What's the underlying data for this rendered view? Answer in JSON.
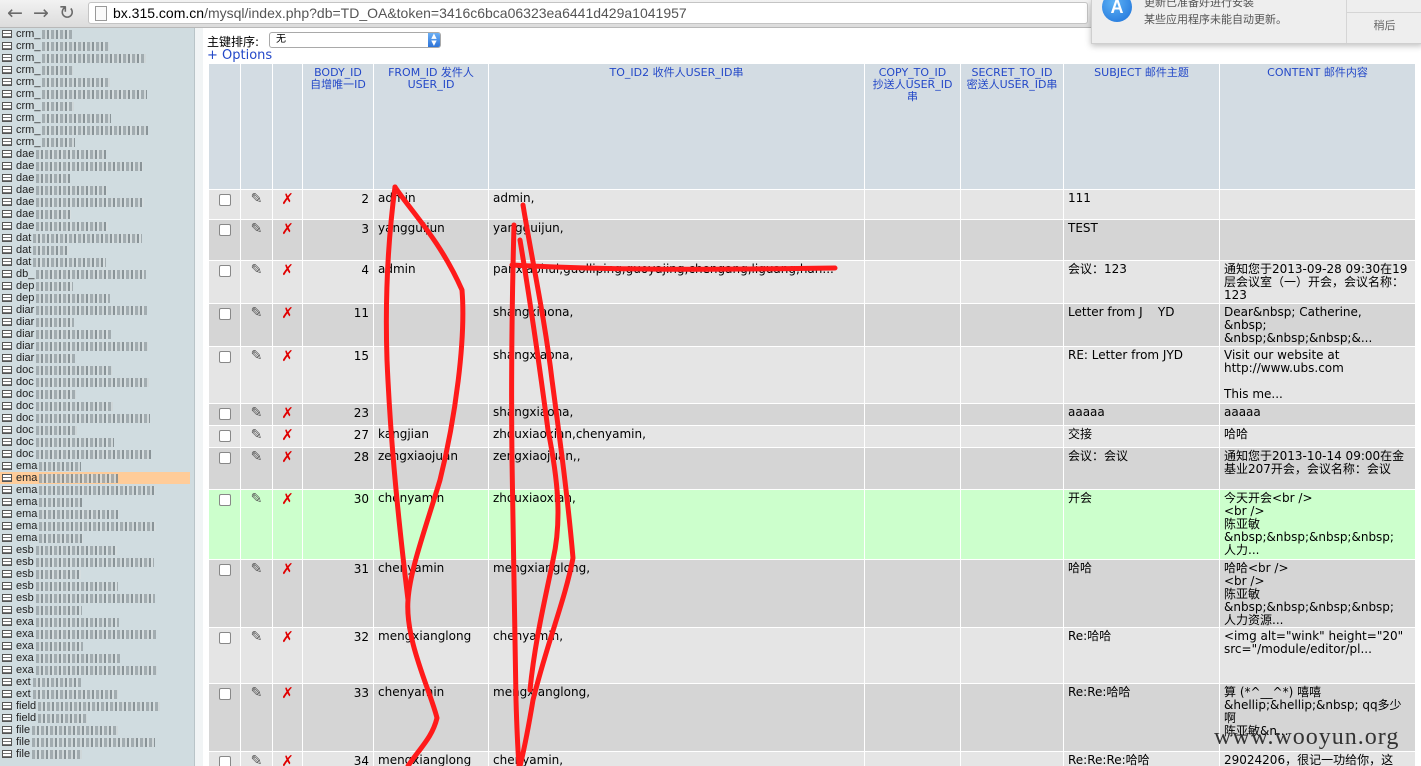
{
  "browser": {
    "url_host": "bx.315.com.cn",
    "url_rest": "/mysql/index.php?db=TD_OA&token=3416c6bca06323ea6441d429a1041957",
    "back_icon": "arrow-left-icon",
    "forward_icon": "arrow-right-icon",
    "reload_icon": "reload-icon"
  },
  "notification": {
    "title": "更新已准备好进行安装",
    "body": "某些应用程序未能自动更新。",
    "later_label": "稍后",
    "icon": "app-store-icon"
  },
  "sidebar": {
    "items": [
      {
        "label": "crm_"
      },
      {
        "label": "crm_"
      },
      {
        "label": "crm_"
      },
      {
        "label": "crm_"
      },
      {
        "label": "crm_"
      },
      {
        "label": "crm_"
      },
      {
        "label": "crm_"
      },
      {
        "label": "crm_"
      },
      {
        "label": "crm_"
      },
      {
        "label": "crm_"
      },
      {
        "label": "dae"
      },
      {
        "label": "dae"
      },
      {
        "label": "dae"
      },
      {
        "label": "dae"
      },
      {
        "label": "dae"
      },
      {
        "label": "dae"
      },
      {
        "label": "dae"
      },
      {
        "label": "dat"
      },
      {
        "label": "dat"
      },
      {
        "label": "dat"
      },
      {
        "label": "db_"
      },
      {
        "label": "dep"
      },
      {
        "label": "dep"
      },
      {
        "label": "diar"
      },
      {
        "label": "diar"
      },
      {
        "label": "diar"
      },
      {
        "label": "diar"
      },
      {
        "label": "diar"
      },
      {
        "label": "doc"
      },
      {
        "label": "doc"
      },
      {
        "label": "doc"
      },
      {
        "label": "doc"
      },
      {
        "label": "doc"
      },
      {
        "label": "doc"
      },
      {
        "label": "doc"
      },
      {
        "label": "doc"
      },
      {
        "label": "ema"
      },
      {
        "label": "ema",
        "active": true
      },
      {
        "label": "ema"
      },
      {
        "label": "ema"
      },
      {
        "label": "ema"
      },
      {
        "label": "ema"
      },
      {
        "label": "ema"
      },
      {
        "label": "esb"
      },
      {
        "label": "esb"
      },
      {
        "label": "esb"
      },
      {
        "label": "esb"
      },
      {
        "label": "esb"
      },
      {
        "label": "esb"
      },
      {
        "label": "exa"
      },
      {
        "label": "exa"
      },
      {
        "label": "exa"
      },
      {
        "label": "exa"
      },
      {
        "label": "exa"
      },
      {
        "label": "ext"
      },
      {
        "label": "ext"
      },
      {
        "label": "field"
      },
      {
        "label": "field"
      },
      {
        "label": "file"
      },
      {
        "label": "file"
      },
      {
        "label": "file"
      }
    ]
  },
  "controls": {
    "sort_label": "主键排序:",
    "sort_value": "无",
    "options_label": "+ Options"
  },
  "table": {
    "columns": [
      {
        "name": "BODY_ID",
        "comment": "自增唯一ID"
      },
      {
        "name": "FROM_ID",
        "comment": "发件人USER_ID"
      },
      {
        "name": "TO_ID2",
        "comment": "收件人USER_ID串"
      },
      {
        "name": "COPY_TO_ID",
        "comment": "抄送人USER_ID串"
      },
      {
        "name": "SECRET_TO_ID",
        "comment": "密送人USER_ID串"
      },
      {
        "name": "SUBJECT",
        "comment": "邮件主题"
      },
      {
        "name": "CONTENT",
        "comment": "邮件内容"
      }
    ],
    "rows": [
      {
        "body_id": "2",
        "from_id": "admin",
        "to_id2": "admin,",
        "copy": "",
        "secret": "",
        "subject": "111",
        "content": ""
      },
      {
        "body_id": "3",
        "from_id": "yangguijun",
        "to_id2": "yangguijun,",
        "copy": "",
        "secret": "",
        "subject": "TEST",
        "content": ""
      },
      {
        "body_id": "4",
        "from_id": "admin",
        "to_id2": "panxiaohui,guolliping,guoyajing,chengang,liguang,han...",
        "copy": "",
        "secret": "",
        "subject": "会议：123",
        "content": "通知您于2013-09-28 09:30在19层会议室（一）开会，会议名称：123"
      },
      {
        "body_id": "11",
        "from_id": "",
        "to_id2": "shangxiaona,",
        "copy": "",
        "secret": "",
        "subject": "Letter from J    YD",
        "content": "Dear&nbsp; Catherine,\n&nbsp;\n&nbsp;&nbsp;&nbsp;&..."
      },
      {
        "body_id": "15",
        "from_id": "",
        "to_id2": "shangxiaona,",
        "copy": "",
        "secret": "",
        "subject": "RE: Letter from JYD",
        "content": "Visit our website at\nhttp://www.ubs.com\n\nThis me..."
      },
      {
        "body_id": "23",
        "from_id": "",
        "to_id2": "shangxiaona,",
        "copy": "",
        "secret": "",
        "subject": "aaaaa",
        "content": "aaaaa"
      },
      {
        "body_id": "27",
        "from_id": "kangjian",
        "to_id2": "zhouxiaoxian,chenyamin,",
        "copy": "",
        "secret": "",
        "subject": "交接",
        "content": "哈哈"
      },
      {
        "body_id": "28",
        "from_id": "zengxiaojuan",
        "to_id2": "zengxiaojuan,,",
        "copy": "",
        "secret": "",
        "subject": "会议：会议",
        "content": "通知您于2013-10-14 09:00在金基业207开会，会议名称：会议"
      },
      {
        "body_id": "30",
        "from_id": "chenyamin",
        "to_id2": "zhouxiaoxian,",
        "copy": "",
        "secret": "",
        "subject": "开会",
        "content": "今天开会<br />\n<br />\n陈亚敏\n&nbsp;&nbsp;&nbsp;&nbsp;\n人力...",
        "highlight": true
      },
      {
        "body_id": "31",
        "from_id": "chenyamin",
        "to_id2": "mengxianglong,",
        "copy": "",
        "secret": "",
        "subject": "哈哈",
        "content": "哈哈<br />\n<br />\n陈亚敏\n&nbsp;&nbsp;&nbsp;&nbsp;\n人力资源..."
      },
      {
        "body_id": "32",
        "from_id": "mengxianglong",
        "to_id2": "chenyamin,",
        "copy": "",
        "secret": "",
        "subject": "Re:哈哈",
        "content": "<img alt=\"wink\" height=\"20\"\nsrc=\"/module/editor/pl..."
      },
      {
        "body_id": "33",
        "from_id": "chenyamin",
        "to_id2": "mengxianglong,",
        "copy": "",
        "secret": "",
        "subject": "Re:Re:哈哈",
        "content": "算 (*^__^*) 嘻嘻\n&hellip;&hellip;&nbsp; qq多少啊\n陈亚敏&n..."
      },
      {
        "body_id": "34",
        "from_id": "mengxianglong",
        "to_id2": "chenyamin,",
        "copy": "",
        "secret": "",
        "subject": "Re:Re:Re:哈哈",
        "content": "29024206，很记一功给你，这"
      }
    ]
  },
  "watermark": "www.wooyun.org",
  "colors": {
    "sidebar_bg": "#d0dce0",
    "header_bg": "#d3dce3",
    "header_text": "#2348c8",
    "row_odd": "#e5e5e5",
    "row_even": "#d5d5d5",
    "row_highlight": "#ccffcc",
    "annotation_red": "#ff0000",
    "active_sidebar": "#ffcc99"
  }
}
